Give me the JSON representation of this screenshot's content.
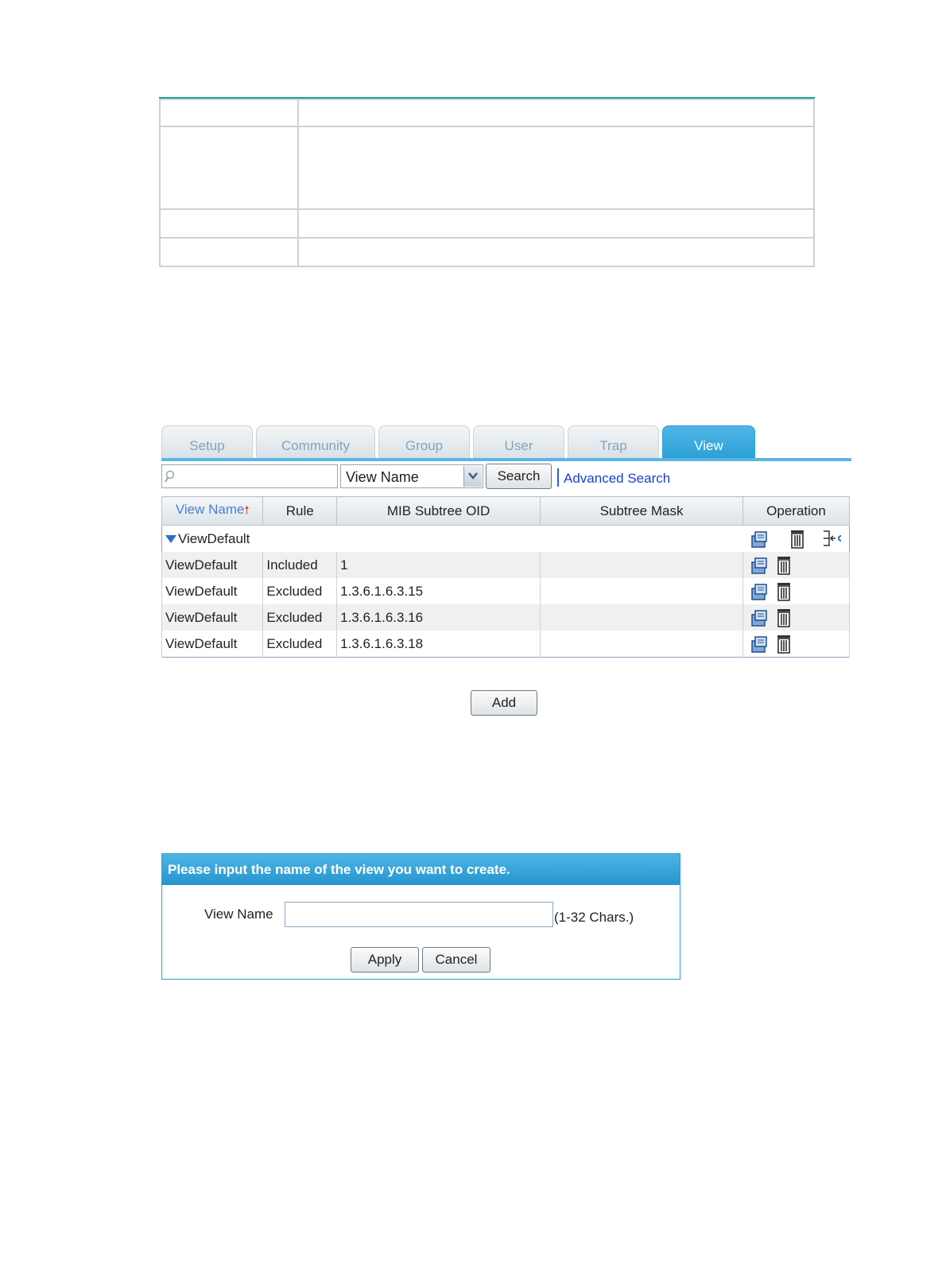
{
  "tabs": [
    {
      "label": "Setup",
      "active": false
    },
    {
      "label": "Community",
      "active": false
    },
    {
      "label": "Group",
      "active": false
    },
    {
      "label": "User",
      "active": false
    },
    {
      "label": "Trap",
      "active": false
    },
    {
      "label": "View",
      "active": true
    }
  ],
  "search": {
    "value": "",
    "field_selected": "View Name",
    "search_label": "Search",
    "advanced_label": "Advanced Search"
  },
  "table": {
    "headers": {
      "view_name": "View Name",
      "rule": "Rule",
      "mib_subtree_oid": "MIB Subtree OID",
      "subtree_mask": "Subtree Mask",
      "operation": "Operation"
    },
    "group_label": "ViewDefault",
    "rows": [
      {
        "view_name": "ViewDefault",
        "rule": "Included",
        "oid": "1",
        "mask": ""
      },
      {
        "view_name": "ViewDefault",
        "rule": "Excluded",
        "oid": "1.3.6.1.6.3.15",
        "mask": ""
      },
      {
        "view_name": "ViewDefault",
        "rule": "Excluded",
        "oid": "1.3.6.1.6.3.16",
        "mask": ""
      },
      {
        "view_name": "ViewDefault",
        "rule": "Excluded",
        "oid": "1.3.6.1.6.3.18",
        "mask": ""
      }
    ]
  },
  "add_label": "Add",
  "dialog": {
    "title": "Please input the name of the view you want to create.",
    "view_name_label": "View Name",
    "view_name_value": "",
    "hint": "(1-32 Chars.)",
    "apply_label": "Apply",
    "cancel_label": "Cancel"
  },
  "icons": {
    "search": "magnifier-icon",
    "edit": "edit-rule-icon",
    "delete": "trash-icon",
    "add_rule": "add-rule-icon"
  }
}
